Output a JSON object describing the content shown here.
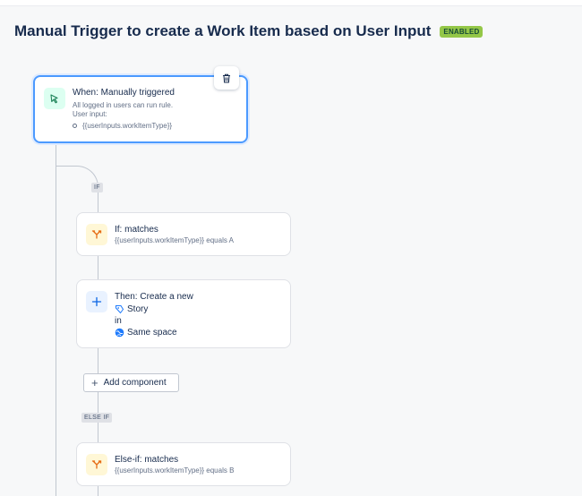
{
  "header": {
    "title": "Manual Trigger to create a Work Item based on User Input",
    "badge": "ENABLED"
  },
  "trigger": {
    "title": "When: Manually triggered",
    "line1": "All logged in users can run rule.",
    "line2": "User input:",
    "input_item": "{{userInputs.workItemType}}"
  },
  "branches": {
    "if_label": "IF",
    "else_if_label": "ELSE IF"
  },
  "if_card": {
    "title": "If: matches",
    "condition": "{{userInputs.workItemType}} equals A"
  },
  "then_card": {
    "title": "Then: Create a new",
    "item_type": "Story",
    "connector": "in",
    "space": "Same space"
  },
  "add_component": {
    "label": "Add component"
  },
  "else_if_card": {
    "title": "Else-if: matches",
    "condition": "{{userInputs.workItemType}} equals B"
  },
  "colors": {
    "accent": "#4c9aff",
    "badge": "#94c748",
    "condition_icon_bg": "#fff7d6",
    "action_icon_bg": "#e9f2ff",
    "trigger_icon_bg": "#dcfff1"
  },
  "icons": {
    "trigger": "manual-trigger-icon",
    "delete": "trash-icon",
    "condition": "branch-condition-icon",
    "action": "plus-icon",
    "story": "story-icon",
    "space": "globe-icon"
  }
}
